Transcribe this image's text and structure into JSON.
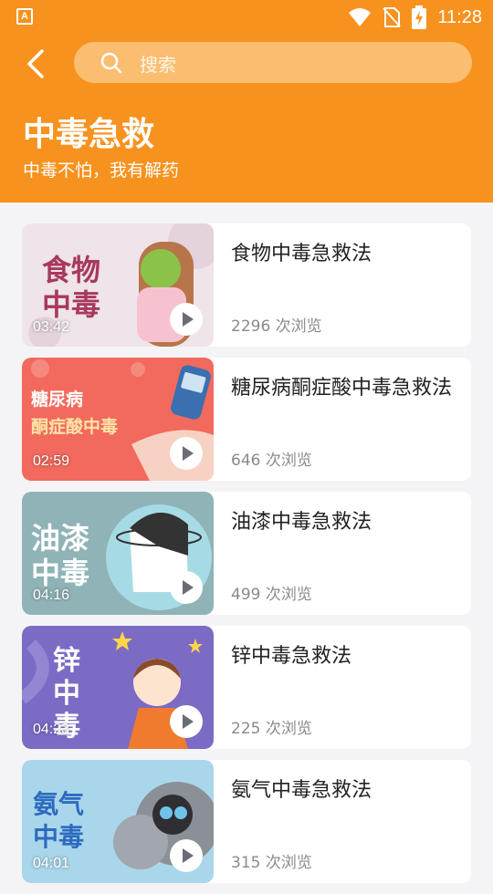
{
  "status_bar": {
    "app_icon": "A",
    "time": "11:28",
    "icons": [
      "wifi-icon",
      "no-sim-icon",
      "battery-charging-icon"
    ]
  },
  "header": {
    "search_placeholder": "搜索",
    "title": "中毒急救",
    "subtitle": "中毒不怕，我有解药"
  },
  "colors": {
    "accent": "#f7921e",
    "search_bg": "#fbbd6f",
    "background": "#f4f4f6"
  },
  "videos": [
    {
      "title": "食物中毒急救法",
      "views": "2296 次浏览",
      "duration": "03:42",
      "thumb_text": [
        "食物",
        "中毒"
      ],
      "thumb_bg": "#efe4ea",
      "thumb_text_color": "#a8395c"
    },
    {
      "title": "糖尿病酮症酸中毒急救法",
      "views": "646 次浏览",
      "duration": "02:59",
      "thumb_text": [
        "糖尿病",
        "酮症酸中毒"
      ],
      "thumb_bg": "#f26a5d",
      "thumb_text_color": "#ffffff"
    },
    {
      "title": "油漆中毒急救法",
      "views": "499 次浏览",
      "duration": "04:16",
      "thumb_text": [
        "油漆",
        "中毒"
      ],
      "thumb_bg": "#8fb3b7",
      "thumb_text_color": "#ffffff"
    },
    {
      "title": "锌中毒急救法",
      "views": "225 次浏览",
      "duration": "04:23",
      "thumb_text": [
        "锌",
        "中",
        "毒"
      ],
      "thumb_bg": "#7c6bc4",
      "thumb_text_color": "#ffffff"
    },
    {
      "title": "氨气中毒急救法",
      "views": "315 次浏览",
      "duration": "04:01",
      "thumb_text": [
        "氨气",
        "中毒"
      ],
      "thumb_bg": "#a9d6ea",
      "thumb_text_color": "#2d6bc0"
    }
  ]
}
